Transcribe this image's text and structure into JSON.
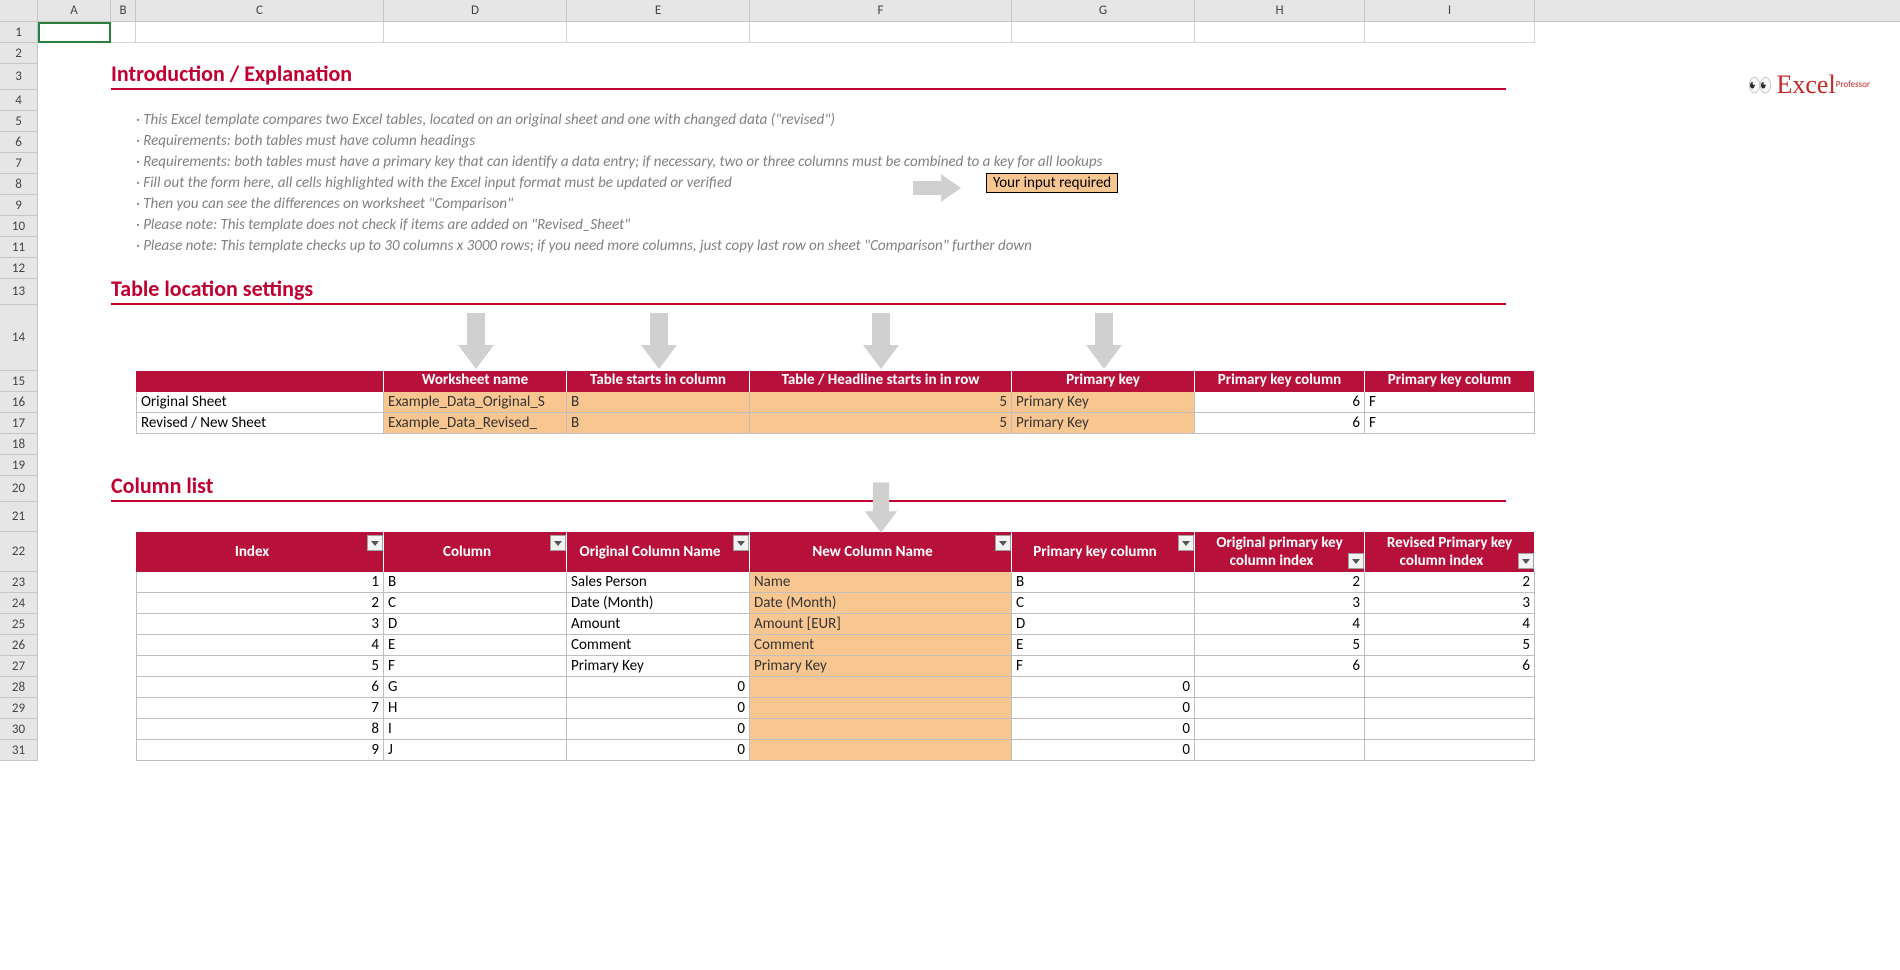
{
  "columns": [
    "A",
    "B",
    "C",
    "D",
    "E",
    "F",
    "G",
    "H",
    "I"
  ],
  "rows": [
    "1",
    "2",
    "3",
    "4",
    "5",
    "6",
    "7",
    "8",
    "9",
    "10",
    "11",
    "12",
    "13",
    "14",
    "15",
    "16",
    "17",
    "18",
    "19",
    "20",
    "21",
    "22",
    "23",
    "24",
    "25",
    "26",
    "27",
    "28",
    "29",
    "30",
    "31"
  ],
  "headings": {
    "intro": "Introduction / Explanation",
    "loc": "Table location settings",
    "cols": "Column list"
  },
  "bullets": [
    "This Excel template compares two Excel tables, located on an original sheet and one with changed data (\"revised\")",
    "Requirements: both tables must have column headings",
    "Requirements: both tables must have a primary key that can identify a data entry; if necessary, two or three columns must be combined to a key for all lookups",
    "Fill out the form here, all cells highlighted with the Excel input format must be updated or verified",
    "Then you can see the differences on worksheet \"Comparison\"",
    "Please note: This template does not check if items are added on \"Revised_Sheet\"",
    "Please note: This template checks up to 30 columns x 3000 rows; if you need more columns, just copy last row on sheet \"Comparison\" further down"
  ],
  "input_note": "Your input required",
  "loc_table": {
    "headers": [
      "Worksheet name",
      "Table starts in column",
      "Table / Headline starts in in row",
      "Primary key",
      "Primary key column",
      "Primary key column"
    ],
    "rowlabels": [
      "Original Sheet",
      "Revised / New Sheet"
    ],
    "rows": [
      {
        "ws": "Example_Data_Original_S",
        "startcol": "B",
        "startrow": "5",
        "pk": "Primary Key",
        "pkcol": "6",
        "pkcol2": "F"
      },
      {
        "ws": "Example_Data_Revised_",
        "startcol": "B",
        "startrow": "5",
        "pk": "Primary Key",
        "pkcol": "6",
        "pkcol2": "F"
      }
    ]
  },
  "col_table": {
    "headers": [
      "Index",
      "Column",
      "Original Column Name",
      "New Column Name",
      "Primary key column",
      "Original primary key column index",
      "Revised Primary key column index"
    ],
    "rows": [
      {
        "idx": "1",
        "col": "B",
        "orig": "Sales Person",
        "new": "Name",
        "pk": "B",
        "o": "2",
        "r": "2"
      },
      {
        "idx": "2",
        "col": "C",
        "orig": "Date (Month)",
        "new": "Date (Month)",
        "pk": "C",
        "o": "3",
        "r": "3"
      },
      {
        "idx": "3",
        "col": "D",
        "orig": "Amount",
        "new": "Amount [EUR]",
        "pk": "D",
        "o": "4",
        "r": "4"
      },
      {
        "idx": "4",
        "col": "E",
        "orig": "Comment",
        "new": "Comment",
        "pk": "E",
        "o": "5",
        "r": "5"
      },
      {
        "idx": "5",
        "col": "F",
        "orig": "Primary Key",
        "new": "Primary Key",
        "pk": "F",
        "o": "6",
        "r": "6"
      },
      {
        "idx": "6",
        "col": "G",
        "orig": "0",
        "new": "",
        "pk": "0",
        "o": "",
        "r": ""
      },
      {
        "idx": "7",
        "col": "H",
        "orig": "0",
        "new": "",
        "pk": "0",
        "o": "",
        "r": ""
      },
      {
        "idx": "8",
        "col": "I",
        "orig": "0",
        "new": "",
        "pk": "0",
        "o": "",
        "r": ""
      },
      {
        "idx": "9",
        "col": "J",
        "orig": "0",
        "new": "",
        "pk": "0",
        "o": "",
        "r": ""
      }
    ]
  },
  "logo": {
    "brand": "Excel",
    "sup": "Professor"
  }
}
